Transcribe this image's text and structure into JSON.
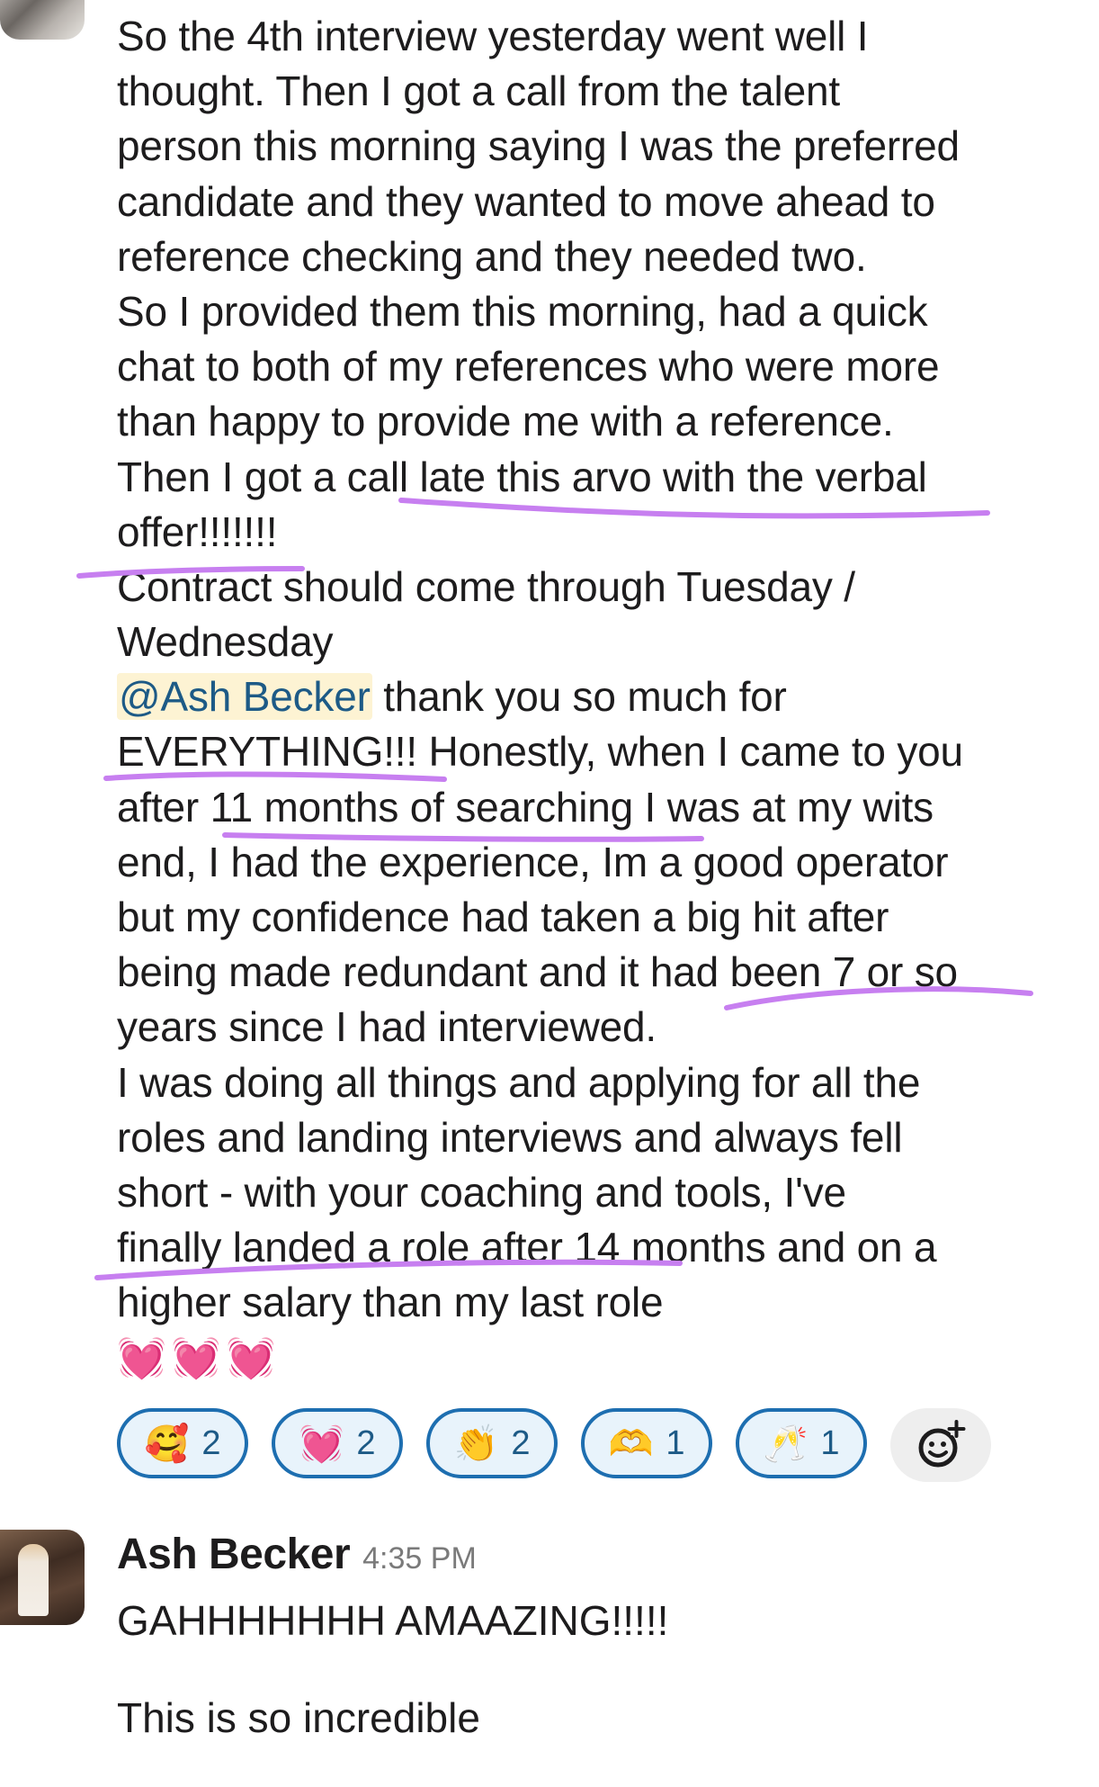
{
  "message": {
    "lines": [
      "So the 4th interview yesterday went well I",
      "thought. Then I got a call from the talent",
      "person this morning saying I was the preferred",
      "candidate and they wanted to move ahead to",
      "reference checking and they needed two.",
      "So I provided them this morning, had a quick",
      "chat to both of my references who were more",
      "than happy to provide me with a reference.",
      "Then I got a call late this arvo with the verbal",
      "offer!!!!!!!",
      "Contract should come through Tuesday /",
      "Wednesday"
    ],
    "mention": "@Ash Becker",
    "mention_rest": " thank you so much for",
    "lines2": [
      "EVERYTHING!!! Honestly, when I came to you",
      "after 11 months of searching I was at my wits",
      "end, I had the experience, Im a good operator",
      "but my confidence had taken a big hit after",
      "being made redundant and it had been 7 or so",
      "years since I had interviewed.",
      "I was doing all things and applying for all the",
      "roles and landing interviews and always fell",
      "short - with your coaching and tools, I've",
      "finally landed a role after 14 months and on a",
      "higher salary than my last role"
    ],
    "hearts": "💓💓💓"
  },
  "reactions": [
    {
      "emoji": "🥰",
      "count": "2"
    },
    {
      "emoji": "💓",
      "count": "2"
    },
    {
      "emoji": "👏",
      "count": "2"
    },
    {
      "emoji": "🫶",
      "count": "1"
    },
    {
      "emoji": "🥂",
      "count": "1"
    }
  ],
  "reply": {
    "sender": "Ash Becker",
    "time": "4:35 PM",
    "line1": "GAHHHHHHH AMAAZING!!!!!",
    "line2": "This is so incredible"
  },
  "colors": {
    "underline": "#c77ff0",
    "reaction_border": "#1d6eb0",
    "mention_bg": "#fdf3d3"
  }
}
